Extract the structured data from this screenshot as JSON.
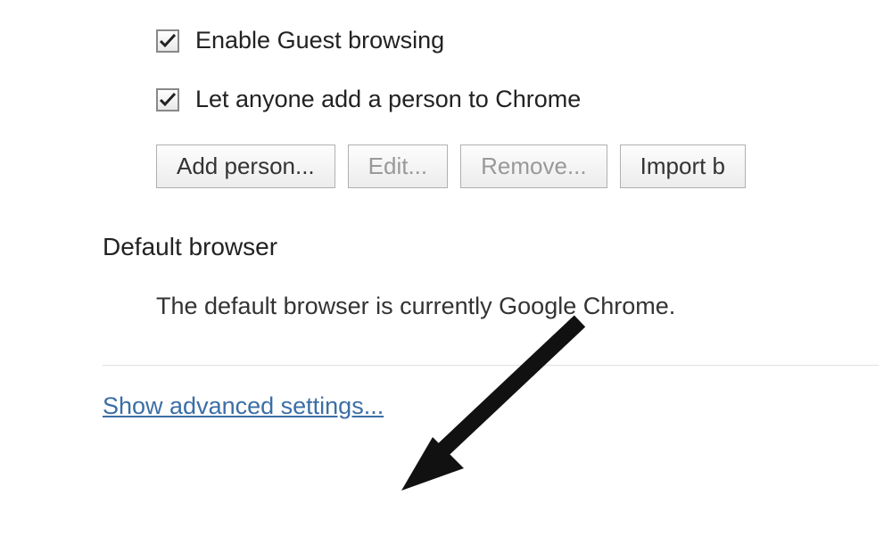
{
  "people": {
    "guestBrowsing": {
      "label": "Enable Guest browsing",
      "checked": true
    },
    "anyoneAdd": {
      "label": "Let anyone add a person to Chrome",
      "checked": true
    },
    "buttons": {
      "addPerson": "Add person...",
      "edit": "Edit...",
      "remove": "Remove...",
      "import": "Import b"
    }
  },
  "defaultBrowser": {
    "title": "Default browser",
    "text": "The default browser is currently Google Chrome."
  },
  "showAdvanced": "Show advanced settings..."
}
